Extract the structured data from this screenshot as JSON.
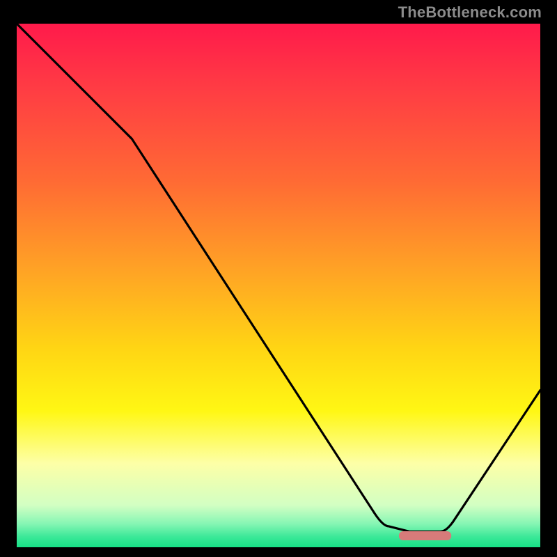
{
  "watermark": "TheBottleneck.com",
  "chart_data": {
    "type": "line",
    "title": "",
    "xlabel": "",
    "ylabel": "",
    "xlim": [
      0,
      100
    ],
    "ylim": [
      0,
      100
    ],
    "grid": false,
    "legend": false,
    "series": [
      {
        "name": "curve",
        "x": [
          0,
          22,
          70,
          75,
          82,
          100
        ],
        "y": [
          100,
          78,
          4,
          3,
          3,
          30
        ]
      }
    ],
    "marker": {
      "name": "bottleneck-range",
      "x_start": 73,
      "x_end": 83,
      "y": 2.2,
      "color": "#d77b7a"
    },
    "gradient_stops": [
      {
        "offset": 0.0,
        "color": "#ff1a4b"
      },
      {
        "offset": 0.12,
        "color": "#ff3b44"
      },
      {
        "offset": 0.3,
        "color": "#ff6a34"
      },
      {
        "offset": 0.48,
        "color": "#ffa624"
      },
      {
        "offset": 0.62,
        "color": "#ffd514"
      },
      {
        "offset": 0.74,
        "color": "#fff714"
      },
      {
        "offset": 0.84,
        "color": "#fdffa7"
      },
      {
        "offset": 0.92,
        "color": "#d2ffc3"
      },
      {
        "offset": 0.955,
        "color": "#86f6b4"
      },
      {
        "offset": 0.98,
        "color": "#3be898"
      },
      {
        "offset": 1.0,
        "color": "#17e187"
      }
    ]
  }
}
